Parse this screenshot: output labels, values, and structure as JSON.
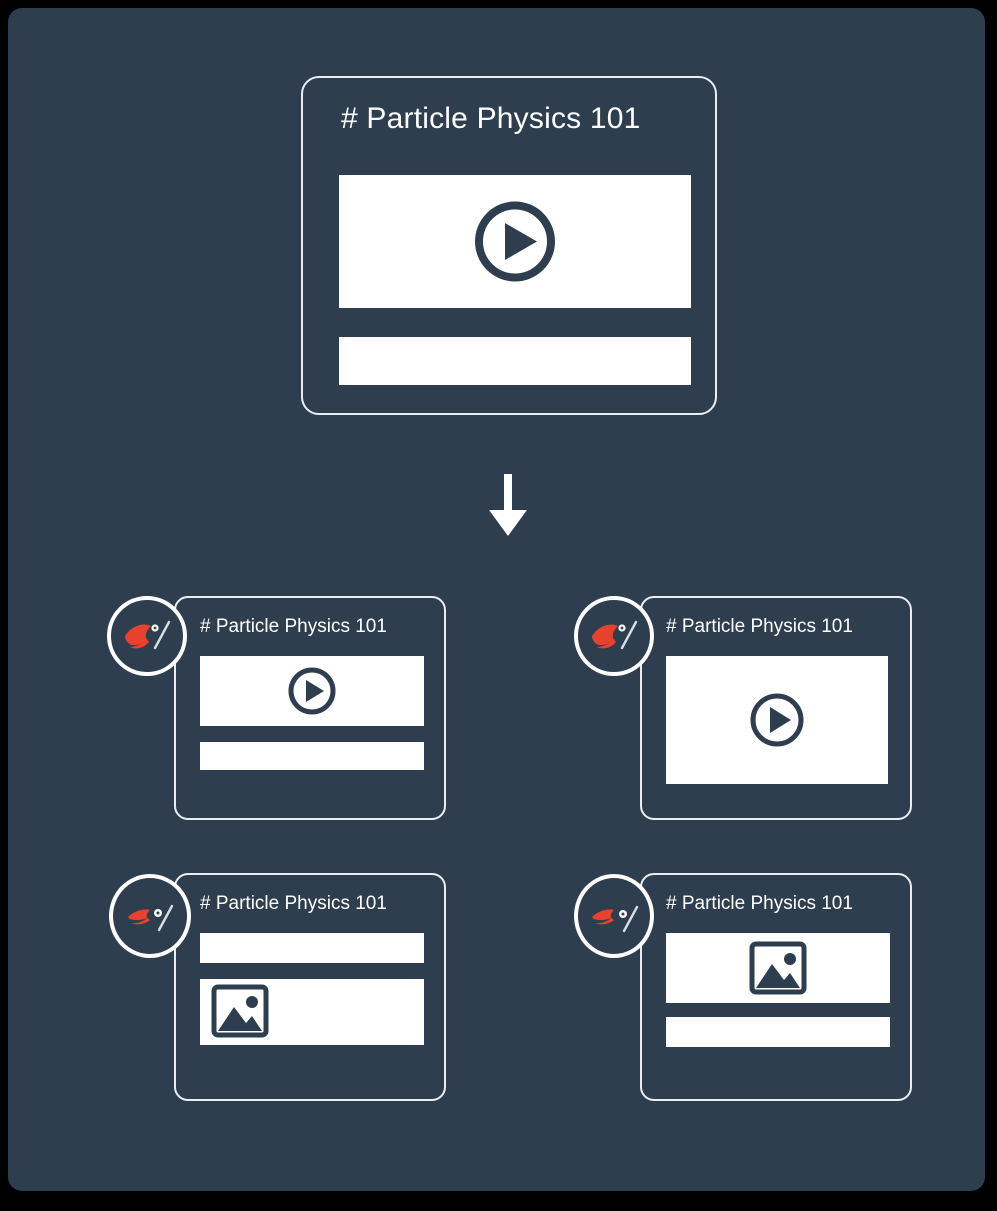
{
  "theme": {
    "page_background": "#000000",
    "canvas_background": "#2E3E4E",
    "card_border": "#E9EEF2",
    "block_fill": "#FFFFFF",
    "text_color": "#FFFFFF",
    "accent_red": "#E8412E",
    "icon_navy": "#2E3E4E"
  },
  "source": {
    "title": "# Particle Physics 101",
    "blocks": [
      {
        "kind": "video",
        "icon": "play-icon"
      },
      {
        "kind": "bar",
        "icon": ""
      }
    ]
  },
  "flow": {
    "arrow": "arrow-down-icon"
  },
  "outputs": [
    {
      "id": "card-1",
      "title": "# Particle Physics 101",
      "avatar_icon": "bird-logo-icon",
      "blocks": [
        {
          "kind": "video",
          "icon": "play-icon"
        },
        {
          "kind": "bar",
          "icon": ""
        }
      ]
    },
    {
      "id": "card-2",
      "title": "# Particle Physics 101",
      "avatar_icon": "bird-logo-icon",
      "blocks": [
        {
          "kind": "video-large",
          "icon": "play-icon"
        }
      ]
    },
    {
      "id": "card-3",
      "title": "# Particle Physics 101",
      "avatar_icon": "bird-logo-icon",
      "blocks": [
        {
          "kind": "bar",
          "icon": ""
        },
        {
          "kind": "image-left",
          "icon": "image-icon"
        }
      ]
    },
    {
      "id": "card-4",
      "title": "# Particle Physics 101",
      "avatar_icon": "bird-logo-icon",
      "blocks": [
        {
          "kind": "image-center",
          "icon": "image-icon"
        },
        {
          "kind": "bar",
          "icon": ""
        }
      ]
    }
  ]
}
